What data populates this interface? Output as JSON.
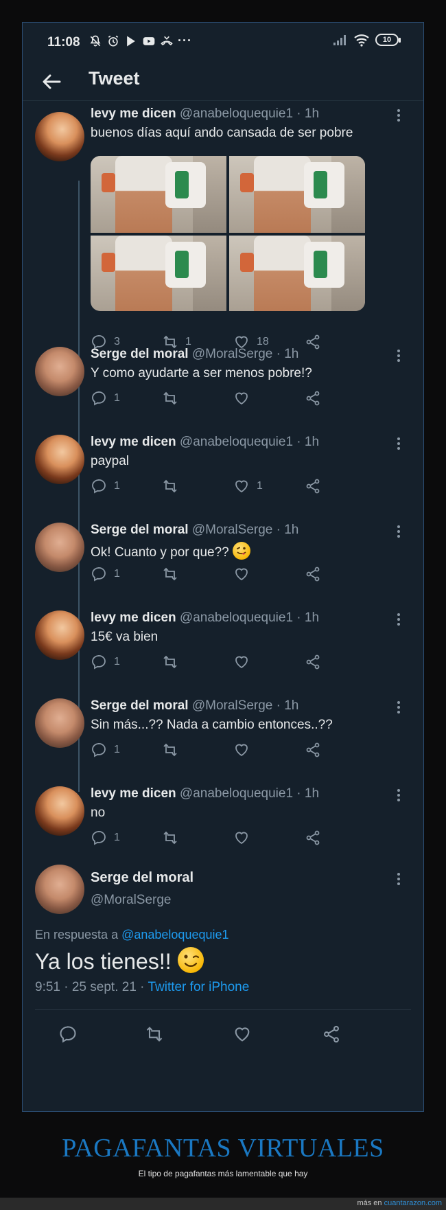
{
  "status_bar": {
    "time": "11:08",
    "more": "···",
    "battery": "10"
  },
  "header": {
    "title": "Tweet"
  },
  "tweets": [
    {
      "name": "levy me dicen",
      "handle": "@anabeloquequie1",
      "time": "· 1h",
      "text": "buenos días aquí ando cansada de ser pobre",
      "replies": "3",
      "retweets": "1",
      "likes": "18",
      "avatar": "levy"
    },
    {
      "name": "Serge del moral",
      "handle": "@MoralSerge",
      "time": "· 1h",
      "text": "Y como ayudarte a ser menos pobre!?",
      "replies": "1",
      "retweets": "",
      "likes": "",
      "avatar": "serge"
    },
    {
      "name": "levy me dicen",
      "handle": "@anabeloquequie1",
      "time": "· 1h",
      "text": "paypal",
      "replies": "1",
      "retweets": "",
      "likes": "1",
      "avatar": "levy"
    },
    {
      "name": "Serge del moral",
      "handle": "@MoralSerge",
      "time": "· 1h",
      "text": "Ok! Cuanto y por que??",
      "replies": "1",
      "retweets": "",
      "likes": "",
      "avatar": "serge",
      "emoji": "winking-tongue"
    },
    {
      "name": "levy me dicen",
      "handle": "@anabeloquequie1",
      "time": "· 1h",
      "text": "15€ va bien",
      "replies": "1",
      "retweets": "",
      "likes": "",
      "avatar": "levy"
    },
    {
      "name": "Serge del moral",
      "handle": "@MoralSerge",
      "time": "· 1h",
      "text": "Sin más...?? Nada a cambio entonces..??",
      "replies": "1",
      "retweets": "",
      "likes": "",
      "avatar": "serge"
    },
    {
      "name": "levy me dicen",
      "handle": "@anabeloquequie1",
      "time": "· 1h",
      "text": "no",
      "replies": "1",
      "retweets": "",
      "likes": "",
      "avatar": "levy"
    }
  ],
  "main_tweet": {
    "name": "Serge del moral",
    "handle": "@MoralSerge",
    "reply_prefix": "En respuesta a",
    "reply_to": "@anabeloquequie1",
    "text": "Ya los tienes!!",
    "emoji": "winking-face",
    "timestamp": "9:51 · 25 sept. 21 ·",
    "source": "Twitter for iPhone"
  },
  "caption": {
    "title": "PAGAFANTAS VIRTUALES",
    "subtitle": "El tipo de pagafantas más lamentable que hay"
  },
  "footer": {
    "prefix": "más en",
    "site": "cuantarazon.com"
  },
  "colors": {
    "background": "#15202b",
    "accent": "#1d9bf0",
    "caption": "#1a78c2"
  }
}
